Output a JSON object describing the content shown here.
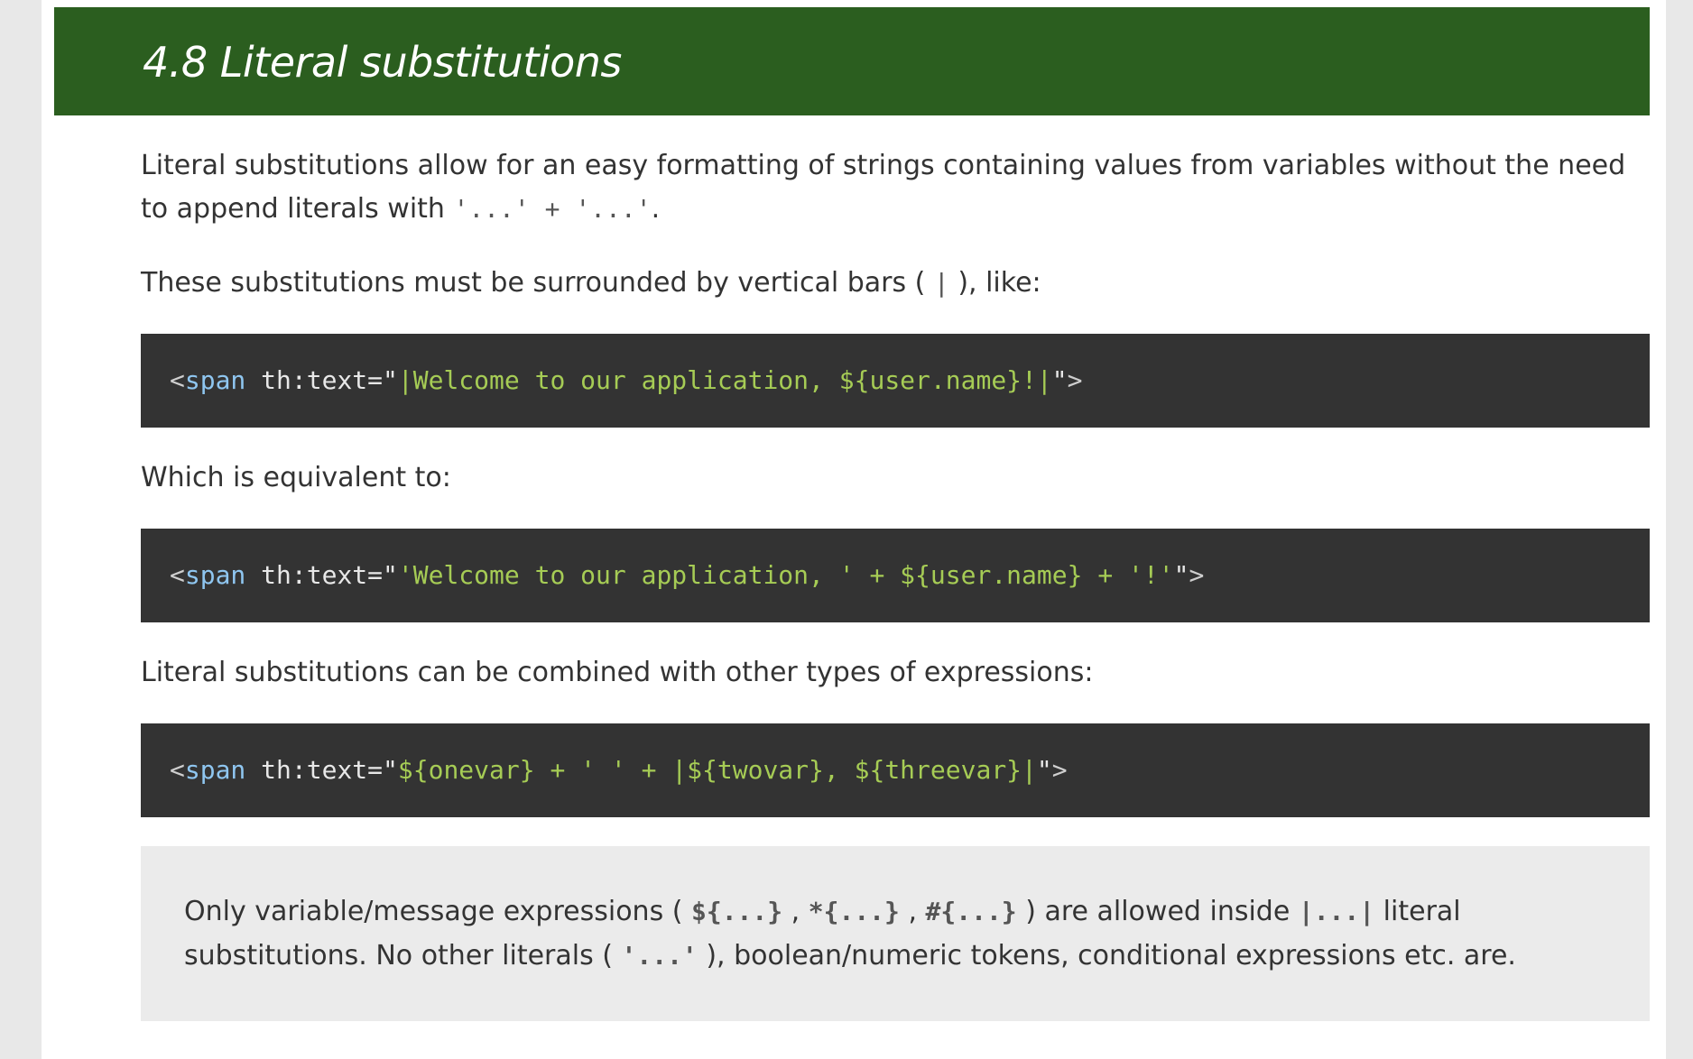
{
  "section": {
    "title": "4.8 Literal substitutions"
  },
  "para1": {
    "text_a": "Literal substitutions allow for an easy formatting of strings containing values from variables without the need to append literals with ",
    "code": "'...' + '...'",
    "text_b": "."
  },
  "para2": {
    "text_a": "These substitutions must be surrounded by vertical bars ( ",
    "code": "|",
    "text_b": " ), like:"
  },
  "code1": {
    "open": "<",
    "tag": "span",
    "attr": " th:text=",
    "quote_open": "\"",
    "value": "|Welcome to our application, ${user.name}!|",
    "quote_close": "\"",
    "close": ">"
  },
  "para3": {
    "text": "Which is equivalent to:"
  },
  "code2": {
    "open": "<",
    "tag": "span",
    "attr": " th:text=",
    "quote_open": "\"",
    "value": "'Welcome to our application, ' + ${user.name} + '!'",
    "quote_close": "\"",
    "close": ">"
  },
  "para4": {
    "text": "Literal substitutions can be combined with other types of expressions:"
  },
  "code3": {
    "open": "<",
    "tag": "span",
    "attr": " th:text=",
    "quote_open": "\"",
    "value": "${onevar} + ' ' + |${twovar}, ${threevar}|",
    "quote_close": "\"",
    "close": ">"
  },
  "note": {
    "t1": "Only variable/message expressions ( ",
    "c1": "${...}",
    "t2": " , ",
    "c2": "*{...}",
    "t3": " , ",
    "c3": "#{...}",
    "t4": " ) are allowed inside ",
    "c4": "|...|",
    "t5": " literal substitutions. No other literals ( ",
    "c5": "'...'",
    "t6": " ), boolean/numeric tokens, conditional expressions etc. are."
  },
  "colors": {
    "heading_bg": "#2b5e1f",
    "code_bg": "#333333",
    "code_string": "#a6cc55",
    "code_tag": "#8fc6f0",
    "note_bg": "#ebebeb"
  }
}
